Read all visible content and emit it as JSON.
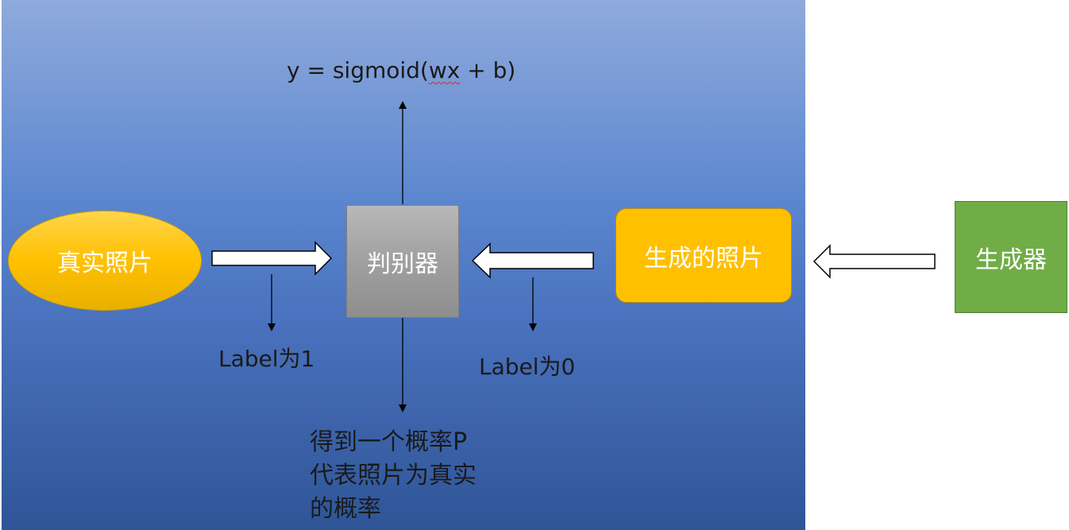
{
  "diagram": {
    "formula": {
      "prefix": "y = sigmoid(",
      "underlined": "wx",
      "suffix": " + b)"
    },
    "nodes": {
      "real_photo": "真实照片",
      "discriminator": "判别器",
      "generated_photo": "生成的照片",
      "generator": "生成器"
    },
    "labels": {
      "real_label": "Label为1",
      "fake_label": "Label为0"
    },
    "output_text": [
      "得到一个概率P",
      "代表照片为真实",
      "的概率"
    ],
    "colors": {
      "slide_background_top": "#8faadc",
      "slide_background_bottom": "#2f5597",
      "real_photo": "#ffc000",
      "discriminator": "#a0a0a0",
      "generated_photo": "#ffc000",
      "generator": "#70ad47",
      "arrow_fill": "#ffffff",
      "text": "#1a1a1a"
    },
    "icons": {
      "block_arrow": "block-arrow-icon",
      "thin_arrow": "thin-arrow-icon"
    }
  }
}
